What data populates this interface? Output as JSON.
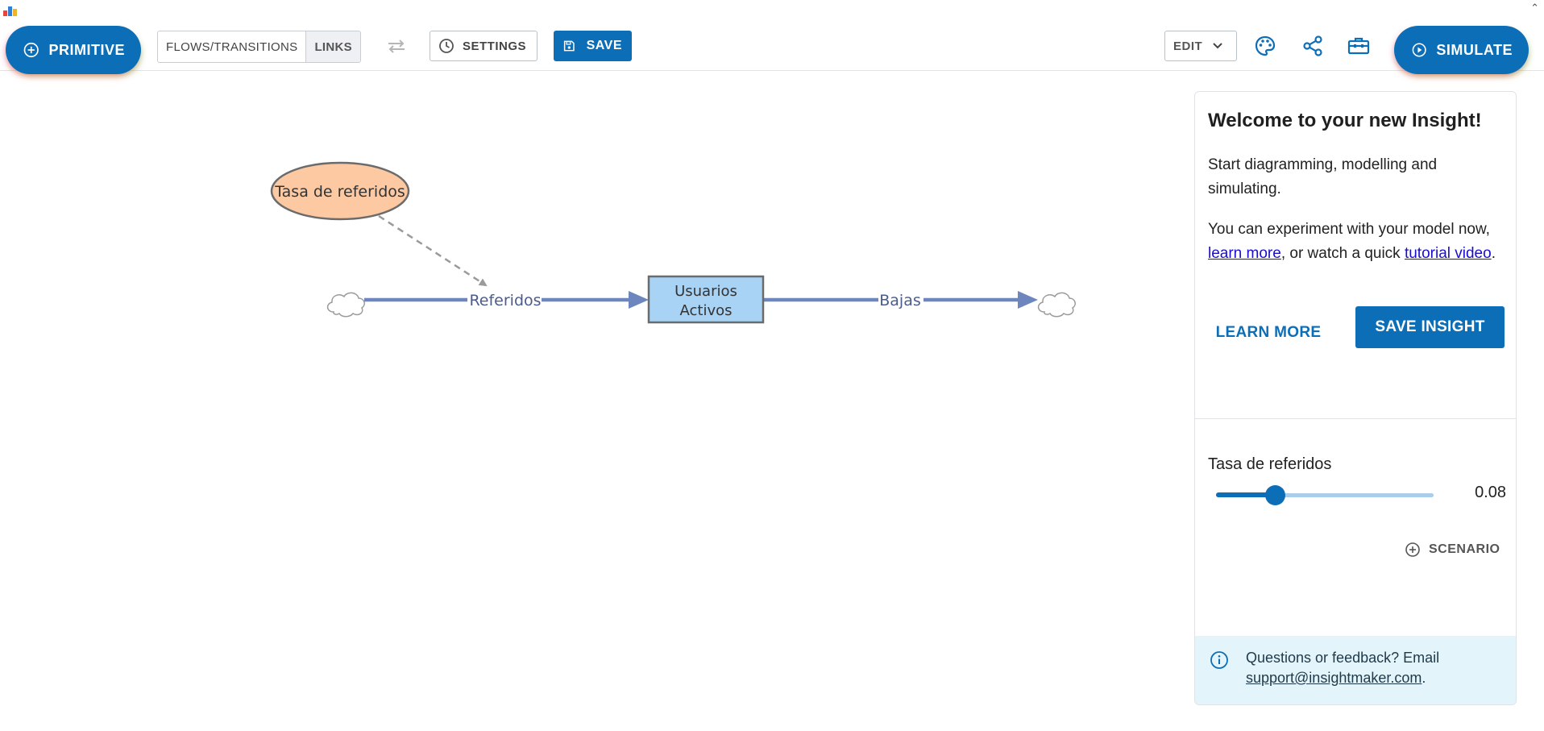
{
  "app": {
    "logo_icon": "insightmaker-logo-icon",
    "collapse_icon": "chevron-up-icon"
  },
  "toolbar": {
    "primitive_label": "PRIMITIVE",
    "flows_transitions_label": "FLOWS/TRANSITIONS",
    "links_label": "LINKS",
    "settings_label": "SETTINGS",
    "save_label": "SAVE",
    "edit_label": "EDIT",
    "simulate_label": "SIMULATE",
    "icons": [
      "add-circle-icon",
      "swap-icon",
      "clock-icon",
      "save-icon",
      "chevron-down-icon",
      "palette-icon",
      "share-icon",
      "toolbox-icon",
      "play-icon"
    ]
  },
  "diagram": {
    "variable": {
      "label": "Tasa de referidos",
      "fill": "#fdc9a2"
    },
    "stock": {
      "label_line1": "Usuarios",
      "label_line2": "Activos",
      "fill": "#a8d3f5"
    },
    "flow_in": {
      "label": "Referidos"
    },
    "flow_out": {
      "label": "Bajas"
    },
    "flow_color": "#6d86bd"
  },
  "panel": {
    "title": "Welcome to your new Insight!",
    "intro": "Start diagramming, modelling and simulating.",
    "experiment_prefix": "You can experiment with your model now, ",
    "learn_more_link": "learn more",
    "experiment_middle": ", or watch a quick ",
    "tutorial_link": "tutorial video",
    "experiment_suffix": ".",
    "learn_more_button": "LEARN MORE",
    "save_insight_button": "SAVE INSIGHT",
    "slider": {
      "label": "Tasa de referidos",
      "value": "0.08",
      "fraction": 0.27
    },
    "scenario_label": "SCENARIO",
    "feedback_prefix": "Questions or feedback? Email ",
    "feedback_email": "support@insightmaker.com",
    "feedback_suffix": "."
  },
  "colors": {
    "accent": "#0d6eb8",
    "feedback_bg": "#e4f4fb"
  }
}
